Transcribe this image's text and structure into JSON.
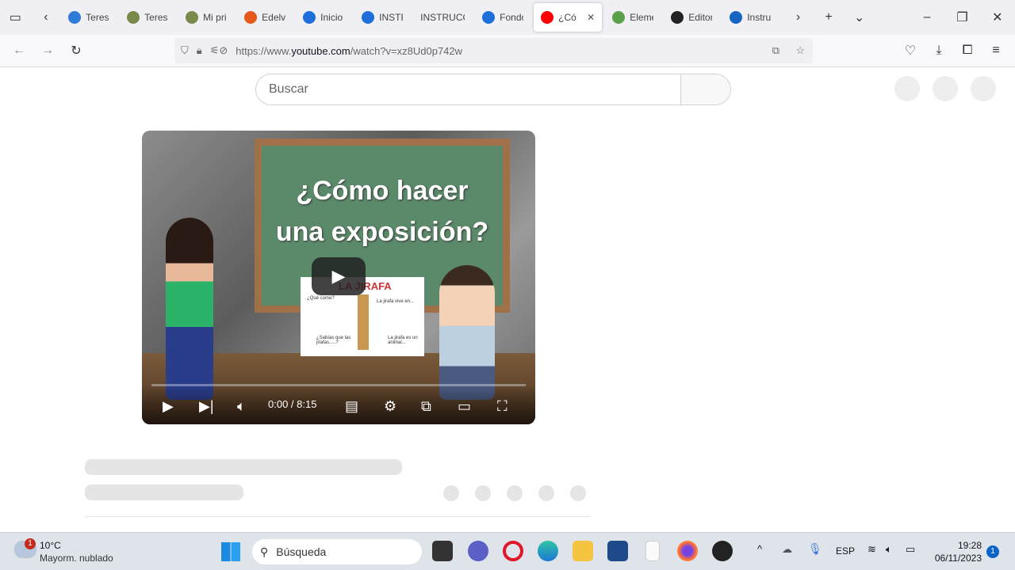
{
  "browser": {
    "tabs": [
      {
        "label": "Teresa",
        "color": "#2f7bd8"
      },
      {
        "label": "Teresa",
        "color": "#7a8a4a"
      },
      {
        "label": "Mi pri",
        "color": "#7a8a4a"
      },
      {
        "label": "Edelvi",
        "color": "#e55a1c"
      },
      {
        "label": "Inicio",
        "color": "#1e6fd9"
      },
      {
        "label": "INSTR",
        "color": "#1e6fd9"
      },
      {
        "label": "INSTRUCC",
        "color": ""
      },
      {
        "label": "Fondo",
        "color": "#1e6fd9"
      },
      {
        "label": "¿Có",
        "color": "#ff0000",
        "active": true
      },
      {
        "label": "Eleme",
        "color": "#5aa14a"
      },
      {
        "label": "Editor",
        "color": "#222"
      },
      {
        "label": "Instru",
        "color": "#1565c0"
      }
    ],
    "url_prefix": "https://www.",
    "url_domain": "youtube.com",
    "url_suffix": "/watch?v=xz8Ud0p742w"
  },
  "youtube": {
    "search_placeholder": "Buscar",
    "video": {
      "title_line1": "¿Cómo hacer",
      "title_line2": "una exposición?",
      "paper_title": "LA JIRAFA",
      "paper_texts": [
        "¿Qué come?",
        "La jirafa vive en...",
        "¿Sabías que las jirafas.....?",
        "La jirafa es un animal..."
      ],
      "time": "0:00 / 8:15",
      "progress": 0
    }
  },
  "taskbar": {
    "weather_temp": "10°C",
    "weather_desc": "Mayorm. nublado",
    "weather_badge": "1",
    "search_placeholder": "Búsqueda",
    "lang": "ESP",
    "time": "19:28",
    "date": "06/11/2023",
    "notif_count": "1"
  }
}
